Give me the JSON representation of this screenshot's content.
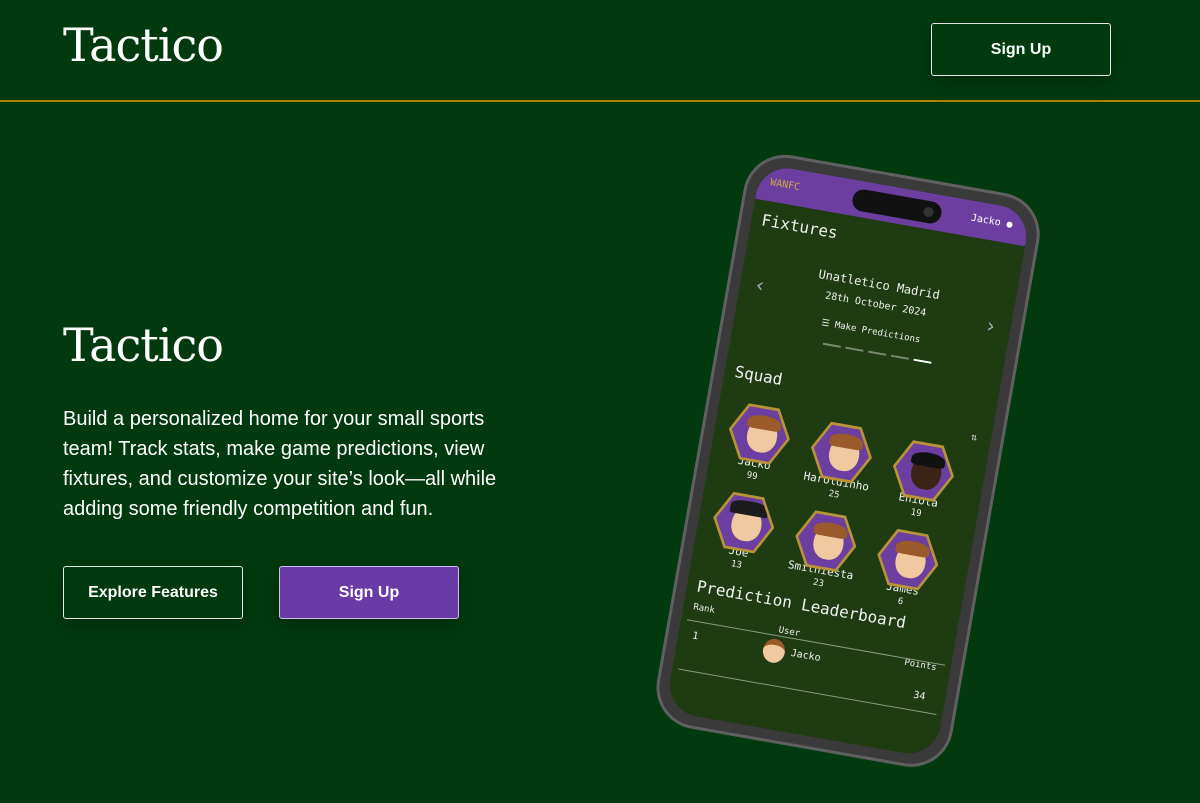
{
  "nav": {
    "brand": "Tactico",
    "signup_label": "Sign Up"
  },
  "hero": {
    "title": "Tactico",
    "description": "Build a personalized home for your small sports team! Track stats, make game predictions, view fixtures, and customize your site’s look—all while adding some friendly competition and fun.",
    "explore_label": "Explore Features",
    "signup_label": "Sign Up"
  },
  "phone": {
    "club": "WANFC",
    "user": "Jacko",
    "fixtures_title": "Fixtures",
    "fixture": {
      "team": "Unatletico Madrid",
      "date": "28th October 2024",
      "action": "Make Predictions"
    },
    "squad_title": "Squad",
    "squad": [
      {
        "name": "Jacko",
        "number": "99"
      },
      {
        "name": "Haroldinho",
        "number": "25"
      },
      {
        "name": "Eniola",
        "number": "19"
      },
      {
        "name": "Joe",
        "number": "13"
      },
      {
        "name": "Smithiesta",
        "number": "23"
      },
      {
        "name": "James",
        "number": "6"
      }
    ],
    "leaderboard": {
      "title": "Prediction Leaderboard",
      "headers": {
        "rank": "Rank",
        "user": "User",
        "points": "Points"
      },
      "rows": [
        {
          "rank": "1",
          "user": "Jacko",
          "points": "34"
        }
      ]
    }
  },
  "colors": {
    "background": "#003a0e",
    "accent_purple": "#6a3aa6",
    "gold": "#a8860e"
  }
}
